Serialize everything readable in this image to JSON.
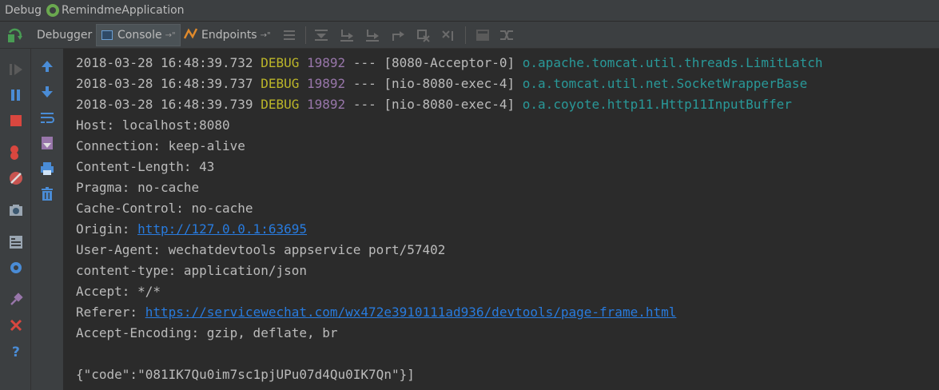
{
  "title_bar": {
    "debug_label": "Debug",
    "app_name": "RemindmeApplication",
    "app_icon": "spring-boot-icon"
  },
  "toolbar": {
    "rerun_icon": "rerun-icon",
    "tabs": [
      {
        "label": "Debugger",
        "active": false
      },
      {
        "label": "Console",
        "active": true,
        "icon": "console-icon",
        "pin": "→\""
      },
      {
        "label": "Endpoints",
        "active": false,
        "icon": "endpoints-icon",
        "pin": "→\""
      }
    ],
    "buttons": [
      "show-execution-point-icon",
      "step-over-icon",
      "step-into-icon",
      "force-step-into-icon",
      "step-out-icon",
      "drop-frame-icon",
      "run-to-cursor-icon",
      "evaluate-expression-icon",
      "trace-icon"
    ]
  },
  "side_strip_outer": [
    "resume-icon",
    "pause-icon",
    "stop-icon",
    "view-breakpoints-icon",
    "mute-breakpoints-icon",
    "get-thread-dump-icon",
    "restore-layout-icon",
    "settings-icon",
    "pin-icon",
    "close-icon",
    "help-icon"
  ],
  "side_strip_inner": [
    "up-arrow-icon",
    "down-arrow-icon",
    "soft-wrap-icon",
    "scroll-to-end-icon",
    "print-icon",
    "clear-all-icon"
  ],
  "colors": {
    "background": "#2b2b2b",
    "panel": "#3c3f41",
    "text": "#bbbbbb",
    "debug_level": "#bbb529",
    "pid": "#9876aa",
    "logger": "#299999",
    "link": "#287bde"
  },
  "console": {
    "log_lines": [
      {
        "timestamp": "2018-03-28 16:48:39.732",
        "level": "DEBUG",
        "pid": "19892",
        "sep": "---",
        "thread": "[8080-Acceptor-0]",
        "logger": "o.apache.tomcat.util.threads.LimitLatch"
      },
      {
        "timestamp": "2018-03-28 16:48:39.737",
        "level": "DEBUG",
        "pid": "19892",
        "sep": "---",
        "thread": "[nio-8080-exec-4]",
        "logger": "o.a.tomcat.util.net.SocketWrapperBase"
      },
      {
        "timestamp": "2018-03-28 16:48:39.739",
        "level": "DEBUG",
        "pid": "19892",
        "sep": "---",
        "thread": "[nio-8080-exec-4]",
        "logger": "o.a.coyote.http11.Http11InputBuffer"
      }
    ],
    "headers": {
      "host": "Host: localhost:8080",
      "connection": "Connection: keep-alive",
      "content_length": "Content-Length: 43",
      "pragma": "Pragma: no-cache",
      "cache_control": "Cache-Control: no-cache",
      "origin_key": "Origin: ",
      "origin_value": "http://127.0.0.1:63695",
      "user_agent": "User-Agent: wechatdevtools appservice port/57402",
      "content_type": "content-type: application/json",
      "accept": "Accept: */*",
      "referer_key": "Referer: ",
      "referer_value": "https://servicewechat.com/wx472e3910111ad936/devtools/page-frame.html",
      "accept_encoding": "Accept-Encoding: gzip, deflate, br"
    },
    "body": "{\"code\":\"081IK7Qu0im7sc1pjUPu07d4Qu0IK7Qn\"}]"
  }
}
